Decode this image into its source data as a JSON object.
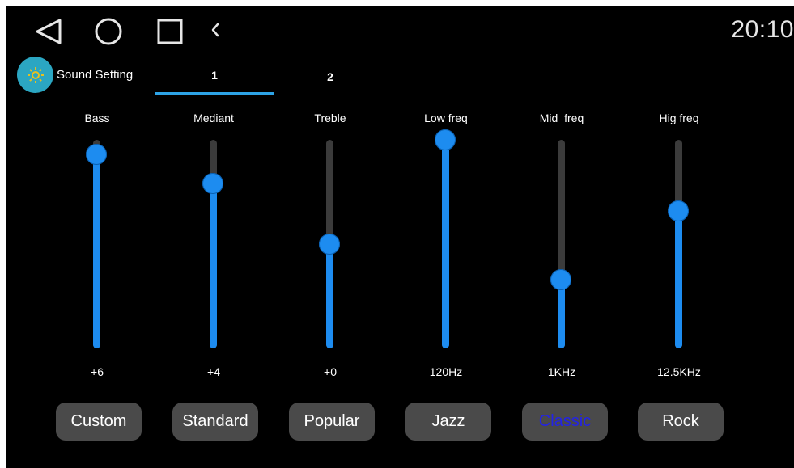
{
  "nav": {
    "back_icon": "triangle-back-icon",
    "home_icon": "circle-home-icon",
    "recent_icon": "square-recent-icon",
    "chevron_icon": "chevron-left-icon"
  },
  "status": {
    "time": "20:10"
  },
  "app": {
    "title": "Sound Setting",
    "icon": "gear-icon",
    "accent": "#2ba6c2"
  },
  "tabs": [
    {
      "label": "1",
      "active": true
    },
    {
      "label": "2",
      "active": false
    }
  ],
  "bands": [
    {
      "label": "Bass",
      "value": "+6",
      "level": 0.93
    },
    {
      "label": "Mediant",
      "value": "+4",
      "level": 0.79
    },
    {
      "label": "Treble",
      "value": "+0",
      "level": 0.5
    },
    {
      "label": "Low freq",
      "value": "120Hz",
      "level": 1.0
    },
    {
      "label": "Mid_freq",
      "value": "1KHz",
      "level": 0.33
    },
    {
      "label": "Hig freq",
      "value": "12.5KHz",
      "level": 0.66
    }
  ],
  "presets": [
    {
      "label": "Custom",
      "selected": false
    },
    {
      "label": "Standard",
      "selected": false
    },
    {
      "label": "Popular",
      "selected": false
    },
    {
      "label": "Jazz",
      "selected": false
    },
    {
      "label": "Classic",
      "selected": true
    },
    {
      "label": "Rock",
      "selected": false
    }
  ],
  "colors": {
    "slider": "#1d8cf0",
    "track": "#3b3b3b",
    "tab_indicator": "#2da3e6",
    "selected_preset_text": "#2323e6"
  }
}
